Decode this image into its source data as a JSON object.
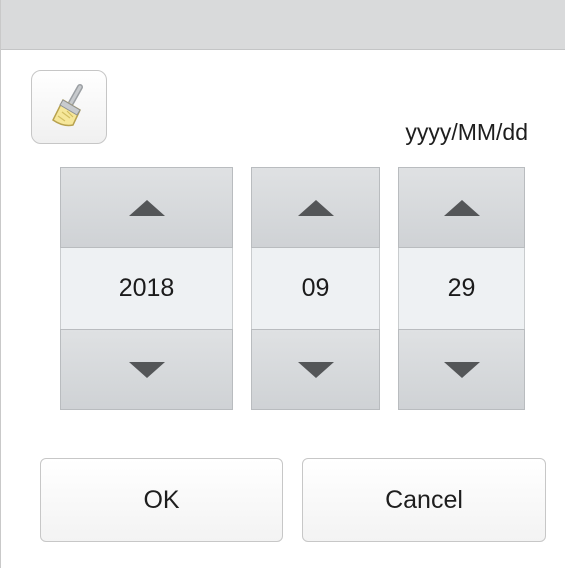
{
  "dialog": {
    "format_label": "yyyy/MM/dd",
    "clear_icon": "broom-icon",
    "year": {
      "value": "2018",
      "up_icon": "triangle-up-icon",
      "down_icon": "triangle-down-icon"
    },
    "month": {
      "value": "09",
      "up_icon": "triangle-up-icon",
      "down_icon": "triangle-down-icon"
    },
    "day": {
      "value": "29",
      "up_icon": "triangle-up-icon",
      "down_icon": "triangle-down-icon"
    },
    "ok_label": "OK",
    "cancel_label": "Cancel"
  },
  "colors": {
    "titlebar": "#d9dadb",
    "spin_button": "#d5d8db",
    "value_background": "#eef1f3",
    "arrow": "#545658"
  }
}
